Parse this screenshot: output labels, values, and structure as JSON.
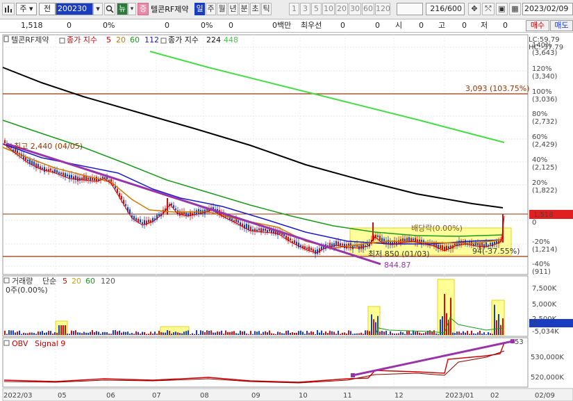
{
  "toolbar": {
    "period_label": "주",
    "prev_label": "전",
    "code": "200230",
    "news_label": "뉴",
    "badge": "증",
    "stock_name": "텔콘RF제약",
    "tabs": [
      "일",
      "주",
      "월",
      "년",
      "분",
      "초",
      "틱"
    ],
    "active_tab": "일",
    "intervals": [
      "1",
      "3",
      "5",
      "10",
      "20",
      "30",
      "60",
      "120"
    ],
    "count": "216/600",
    "date": "2023/02/09"
  },
  "info_bar": {
    "price": "1,518",
    "change": "0",
    "change_pct": "0%",
    "field3": "0",
    "field3_pct": "0%",
    "field4": "0",
    "field4_pct": "0%",
    "volume_label": "0백만",
    "best_label": "최우선",
    "best_val1": "0",
    "best_val2": "0",
    "open_label": "시",
    "open_val": "0",
    "high_label": "고",
    "high_val": "0",
    "low_label": "저",
    "low_val": "0",
    "buy_label": "매수",
    "sell_label": "매도"
  },
  "price_panel": {
    "legend_name": "텔콘RF제약",
    "legend_close": "종가 지수",
    "ma_short": [
      "5",
      "20",
      "60",
      "112"
    ],
    "legend_close2": "종가 지수",
    "ma_long": [
      "224",
      "448"
    ],
    "lc": "LC:59.79",
    "hc": "HC:-37.79",
    "annot_high": "최고 2,440 (04/05)",
    "annot_level": "3,093 (103.75%)",
    "annot_div": "배당락(0.00%)",
    "annot_low": "최저 850 (01/03)",
    "annot_low2": "844.87",
    "annot_pct": "94(-37.55%)",
    "current_price": "1,518",
    "current_zero": "0",
    "yaxis": [
      {
        "pct": "140%",
        "price": "(3,643)"
      },
      {
        "pct": "120%",
        "price": "(3,340)"
      },
      {
        "pct": "100%",
        "price": "(3,036)"
      },
      {
        "pct": "80%",
        "price": "(2,732)"
      },
      {
        "pct": "60%",
        "price": "(2,429)"
      },
      {
        "pct": "40%",
        "price": "(2,125)"
      },
      {
        "pct": "20%",
        "price": "(1,822)"
      },
      {
        "pct": "0",
        "price": ""
      },
      {
        "pct": "-20%",
        "price": "(1,214)"
      },
      {
        "pct": "-40%",
        "price": "(911)"
      }
    ]
  },
  "volume_panel": {
    "legend_label": "거래량",
    "legend_type": "단순",
    "ma": [
      "5",
      "20",
      "60",
      "120"
    ],
    "sub_label": "0주(0.00%)",
    "yaxis": [
      "7,500K",
      "5,000K",
      "2,500K",
      "0",
      "-5,034K"
    ]
  },
  "obv_panel": {
    "legend_label": "OBV",
    "legend_signal": "Signal 9",
    "yaxis": [
      "530,000K",
      "520,000K"
    ],
    "edge_label": "53"
  },
  "xaxis": [
    "2022/03",
    "05",
    "06",
    "07",
    "08",
    "09",
    "10",
    "11",
    "12",
    "2023/01",
    "02",
    "02/09"
  ],
  "colors": {
    "ma5": "#cc0000",
    "ma20": "#d07a00",
    "ma60": "#1a9a1a",
    "ma112": "#1a1acc",
    "ma224": "#000000",
    "ma448": "#44dd44",
    "trend": "#9933aa",
    "level": "#993300",
    "highlight": "#ffff66",
    "price_tag": "#e02020",
    "zero_tag": "#1a3cc0"
  }
}
